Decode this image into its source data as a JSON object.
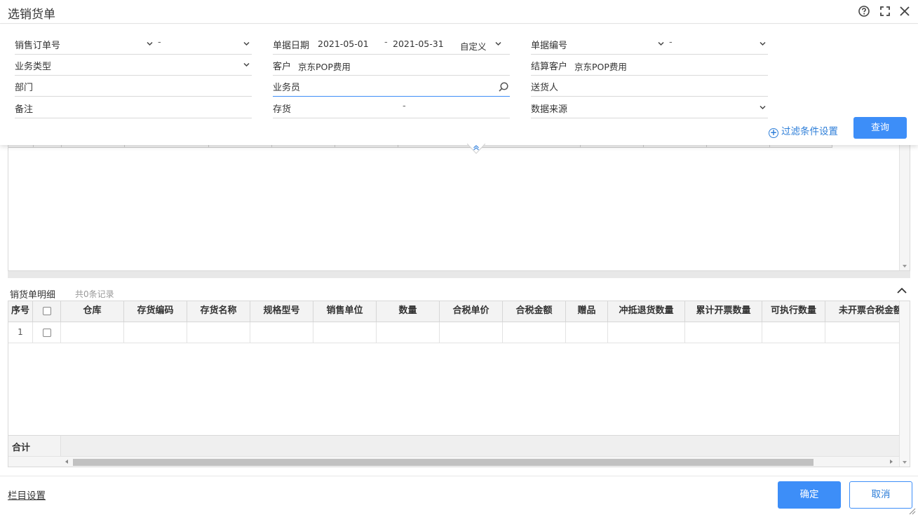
{
  "dialog": {
    "title": "选销货单"
  },
  "filter": {
    "sales_order_no": {
      "label": "销售订单号",
      "separator": "-"
    },
    "doc_date": {
      "label": "单据日期",
      "from": "2021-05-01",
      "separator": "-",
      "to": "2021-05-31",
      "range_mode": "自定义"
    },
    "doc_no": {
      "label": "单据编号",
      "separator": "-"
    },
    "business_type": {
      "label": "业务类型"
    },
    "customer": {
      "label": "客户",
      "value": "京东POP费用"
    },
    "settle_customer": {
      "label": "结算客户",
      "value": "京东POP费用"
    },
    "department": {
      "label": "部门"
    },
    "salesperson": {
      "label": "业务员"
    },
    "deliverer": {
      "label": "送货人"
    },
    "remark": {
      "label": "备注"
    },
    "inventory": {
      "label": "存货",
      "separator": "-"
    },
    "data_source": {
      "label": "数据来源"
    },
    "filter_settings_label": "过滤条件设置",
    "query_label": "查询"
  },
  "detail": {
    "title": "销货单明细",
    "count": "共0条记录",
    "columns": [
      "序号",
      "",
      "仓库",
      "存货编码",
      "存货名称",
      "规格型号",
      "销售单位",
      "数量",
      "合税单价",
      "合税金额",
      "赠品",
      "冲抵退货数量",
      "累计开票数量",
      "可执行数量",
      "未开票合税金额"
    ],
    "rows": [
      {
        "index": "1"
      }
    ],
    "total_label": "合计"
  },
  "footer": {
    "column_settings": "栏目设置",
    "confirm": "确定",
    "cancel": "取消"
  }
}
